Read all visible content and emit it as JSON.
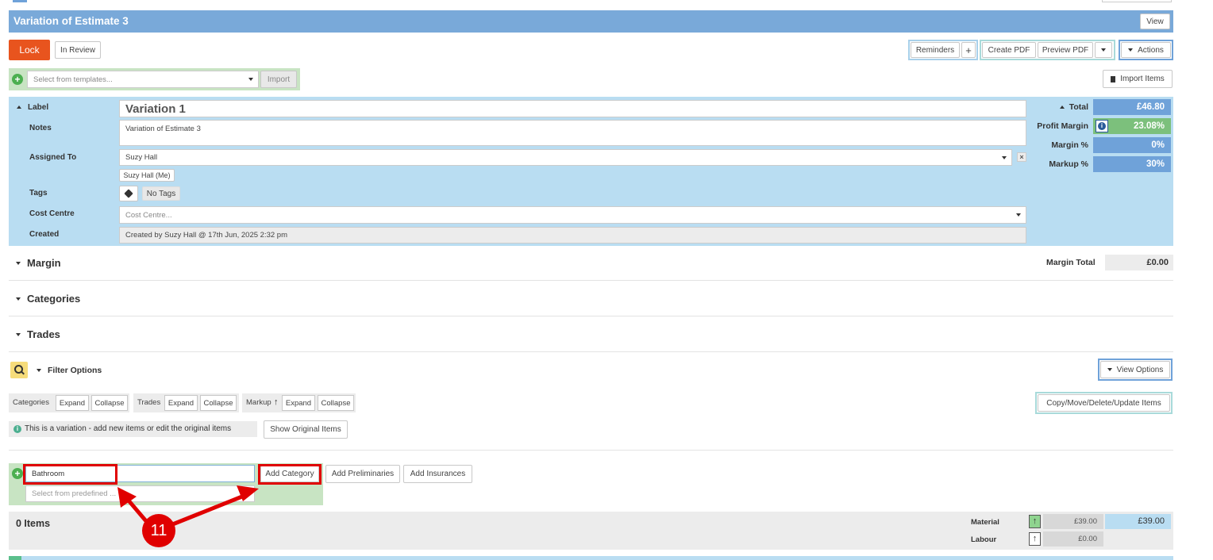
{
  "header": {
    "title": "Variation of Estimate 3",
    "view_label": "View"
  },
  "toolbar": {
    "lock_label": "Lock",
    "in_review_label": "In Review",
    "reminders_label": "Reminders",
    "add_symbol": "+",
    "create_pdf_label": "Create PDF",
    "preview_pdf_label": "Preview PDF",
    "actions_label": "Actions"
  },
  "templates": {
    "placeholder": "Select from templates...",
    "import_label": "Import",
    "import_items_label": "Import Items"
  },
  "details": {
    "label_heading": "Label",
    "label_value": "Variation 1",
    "notes_heading": "Notes",
    "notes_value": "Variation of Estimate 3",
    "assigned_heading": "Assigned To",
    "assigned_value": "Suzy Hall",
    "assigned_chip": "Suzy Hall (Me)",
    "tags_heading": "Tags",
    "tags_value": "No Tags",
    "cost_centre_heading": "Cost Centre",
    "cost_centre_placeholder": "Cost Centre...",
    "created_heading": "Created",
    "created_value": "Created by Suzy Hall @ 17th Jun, 2025 2:32 pm"
  },
  "summary": {
    "total_label": "Total",
    "total_value": "£46.80",
    "profit_margin_label": "Profit Margin",
    "profit_margin_value": "23.08%",
    "margin_pct_label": "Margin %",
    "margin_pct_value": "0%",
    "markup_pct_label": "Markup %",
    "markup_pct_value": "30%"
  },
  "sections": {
    "margin": "Margin",
    "margin_total_label": "Margin Total",
    "margin_total_value": "£0.00",
    "categories": "Categories",
    "trades": "Trades"
  },
  "filters": {
    "filter_options_label": "Filter Options",
    "view_options_label": "View Options",
    "categories_label": "Categories",
    "trades_label": "Trades",
    "markup_label": "Markup",
    "expand_label": "Expand",
    "collapse_label": "Collapse",
    "copy_move_label": "Copy/Move/Delete/Update Items"
  },
  "variation_notice": {
    "text": "This is a variation - add new items or edit the original items",
    "show_original_label": "Show Original Items"
  },
  "add_category": {
    "input_value": "Bathroom",
    "add_category_label": "Add Category",
    "add_preliminaries_label": "Add Preliminaries",
    "add_insurances_label": "Add Insurances",
    "predefined_placeholder": "Select from predefined ..."
  },
  "items": {
    "count_label": "0 Items",
    "material_label": "Material",
    "material_value": "£39.00",
    "material_total": "£39.00",
    "labour_label": "Labour",
    "labour_value": "£0.00"
  },
  "annotation": {
    "step_number": "11"
  },
  "colors": {
    "header_blue": "#79a9d9",
    "panel_blue": "#b9ddf2",
    "lock_orange": "#e8541e",
    "highlight_red": "#e00000"
  }
}
